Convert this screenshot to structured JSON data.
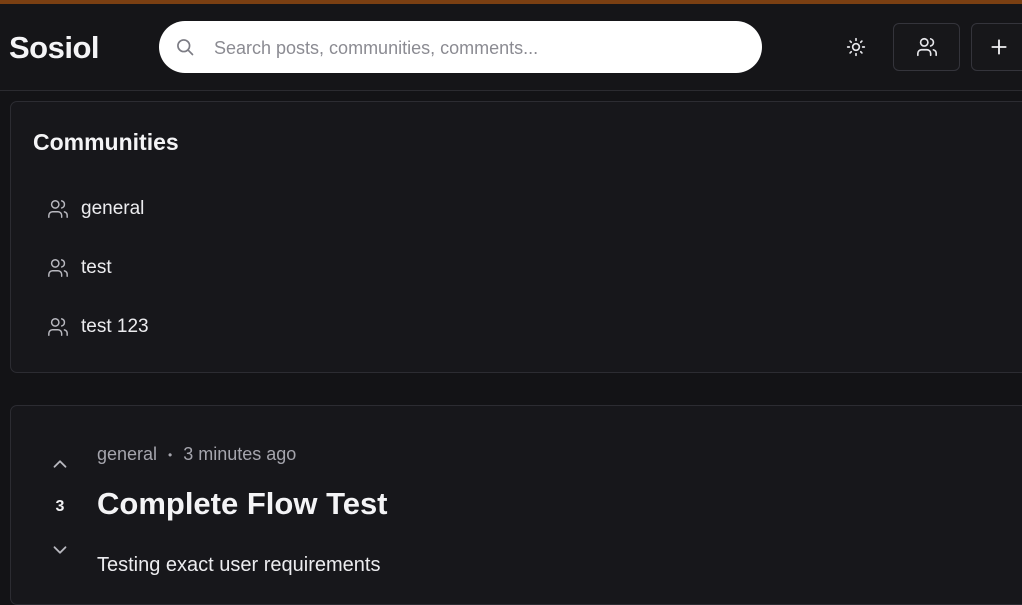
{
  "header": {
    "logo": "Sosiol",
    "search_placeholder": "Search posts, communities, comments..."
  },
  "communities": {
    "title": "Communities",
    "items": [
      {
        "label": "general"
      },
      {
        "label": "test"
      },
      {
        "label": "test 123"
      }
    ]
  },
  "post": {
    "community": "general",
    "separator": "•",
    "time": "3 minutes ago",
    "votes": "3",
    "title": "Complete Flow Test",
    "body": "Testing exact user requirements"
  },
  "colors": {
    "background": "#131316",
    "card": "#17171b",
    "accent_stripe": "#7a3f12",
    "text": "#f1f1f3",
    "muted": "#a5a5ad"
  }
}
